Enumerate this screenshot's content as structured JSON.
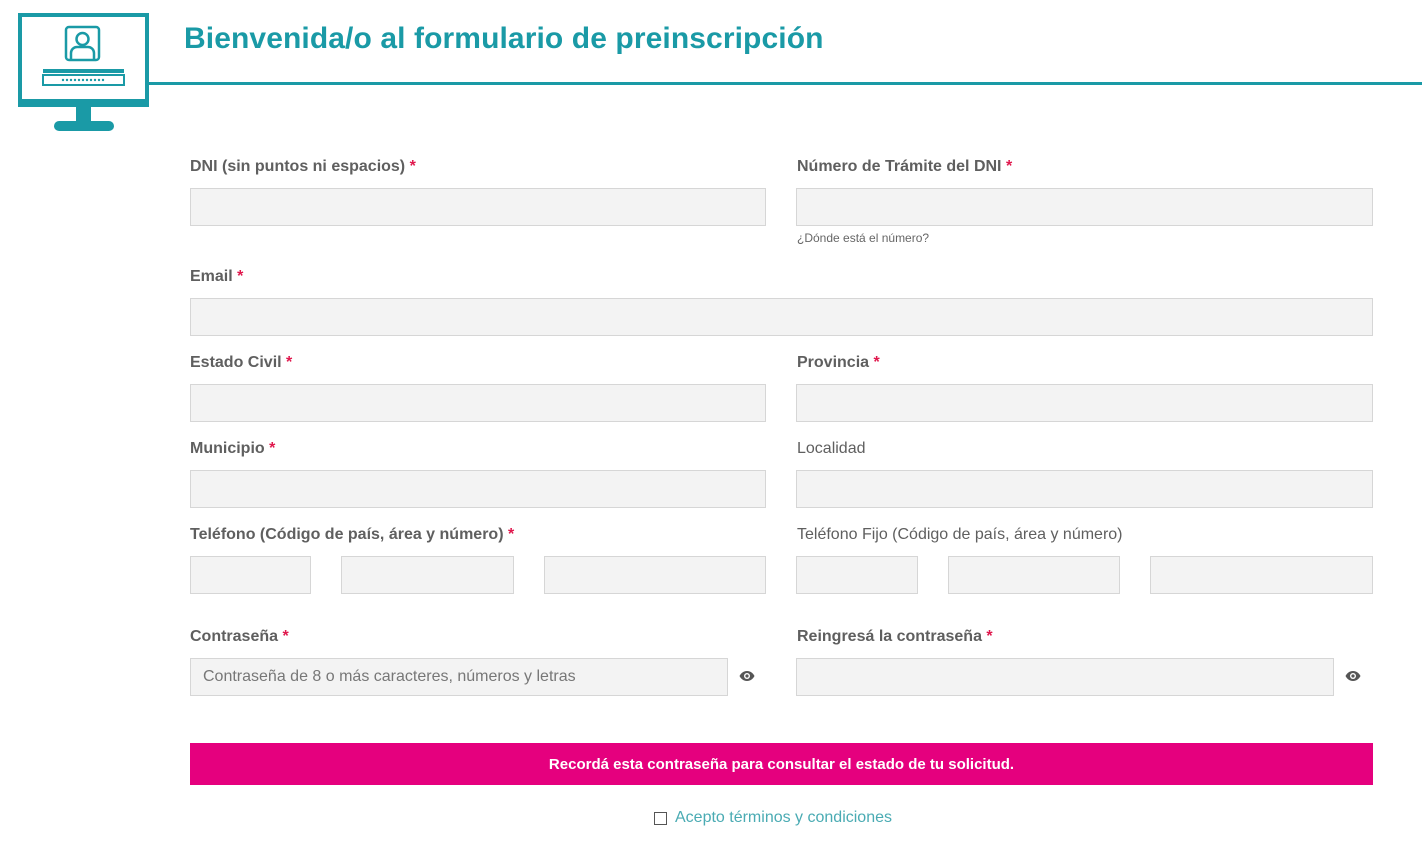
{
  "header": {
    "title": "Bienvenida/o al formulario de preinscripción",
    "brand_color": "#1a9aa6",
    "logo_icon": "computer-login-icon"
  },
  "form": {
    "required_mark": "*",
    "dni": {
      "label": "DNI (sin puntos ni espacios)",
      "value": ""
    },
    "tramite": {
      "label": "Número de Trámite del DNI",
      "value": "",
      "hint": "¿Dónde está el número?"
    },
    "email": {
      "label": "Email",
      "value": ""
    },
    "estado_civil": {
      "label": "Estado Civil",
      "value": ""
    },
    "provincia": {
      "label": "Provincia",
      "value": ""
    },
    "municipio": {
      "label": "Municipio",
      "value": ""
    },
    "localidad": {
      "label": "Localidad",
      "value": ""
    },
    "telefono": {
      "label": "Teléfono (Código de país, área y número)",
      "country": "",
      "area": "",
      "number": ""
    },
    "telefono_fijo": {
      "label": "Teléfono Fijo (Código de país, área y número)",
      "country": "",
      "area": "",
      "number": ""
    },
    "password": {
      "label": "Contraseña",
      "placeholder": "Contraseña de 8 o más caracteres, números y letras",
      "value": "",
      "toggle_icon": "eye-icon"
    },
    "password_confirm": {
      "label": "Reingresá la contraseña",
      "placeholder": "",
      "value": "",
      "toggle_icon": "eye-icon"
    }
  },
  "banner": {
    "text": "Recordá esta contraseña para consultar el estado de tu solicitud.",
    "color": "#e5007e"
  },
  "terms": {
    "label": "Acepto términos y condiciones",
    "checked": false
  }
}
